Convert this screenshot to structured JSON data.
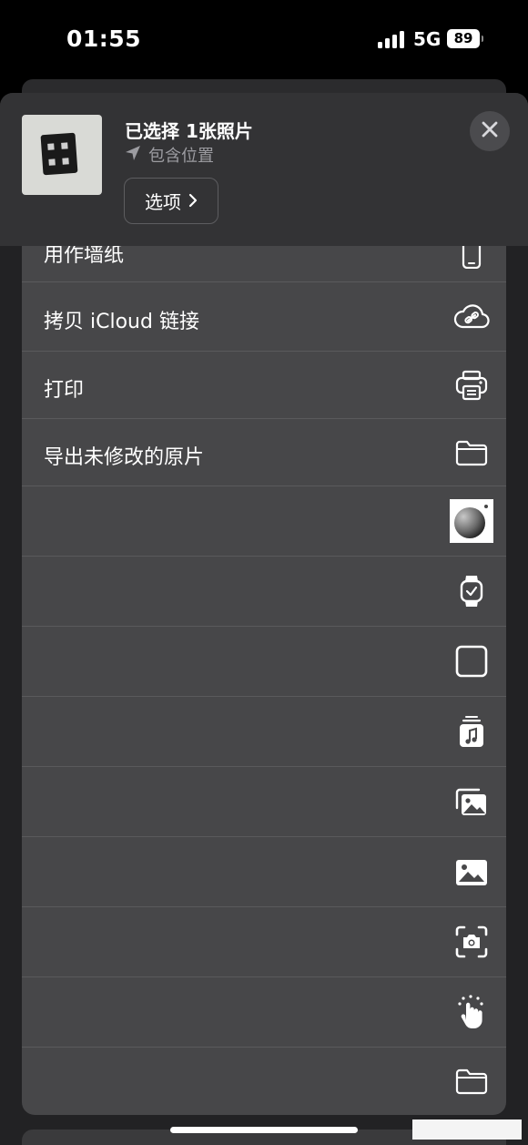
{
  "status_bar": {
    "time": "01:55",
    "network": "5G",
    "battery": "89"
  },
  "header": {
    "title": "已选择 1张照片",
    "subtitle": "包含位置",
    "options_label": "选项",
    "location_icon": "location-arrow-icon",
    "close_icon": "close-icon"
  },
  "actions": [
    {
      "label": "用作墙纸",
      "icon": "iphone-icon"
    },
    {
      "label": "拷贝 iCloud 链接",
      "icon": "icloud-link-icon"
    },
    {
      "label": "打印",
      "icon": "printer-icon"
    },
    {
      "label": "导出未修改的原片",
      "icon": "folder-icon"
    },
    {
      "label": "",
      "icon": "app-sphere-icon"
    },
    {
      "label": "",
      "icon": "watch-icon"
    },
    {
      "label": "",
      "icon": "square-icon"
    },
    {
      "label": "",
      "icon": "music-stack-icon"
    },
    {
      "label": "",
      "icon": "photo-stack-icon"
    },
    {
      "label": "",
      "icon": "photo-icon"
    },
    {
      "label": "",
      "icon": "camera-scan-icon"
    },
    {
      "label": "",
      "icon": "hand-tap-icon"
    },
    {
      "label": "",
      "icon": "folder-icon"
    }
  ],
  "colors": {
    "background": "#000000",
    "sheet": "#222224",
    "header": "#333335",
    "list_card": "#474749",
    "divider": "#5a5a5c",
    "secondary_text": "#9c9ca1"
  }
}
